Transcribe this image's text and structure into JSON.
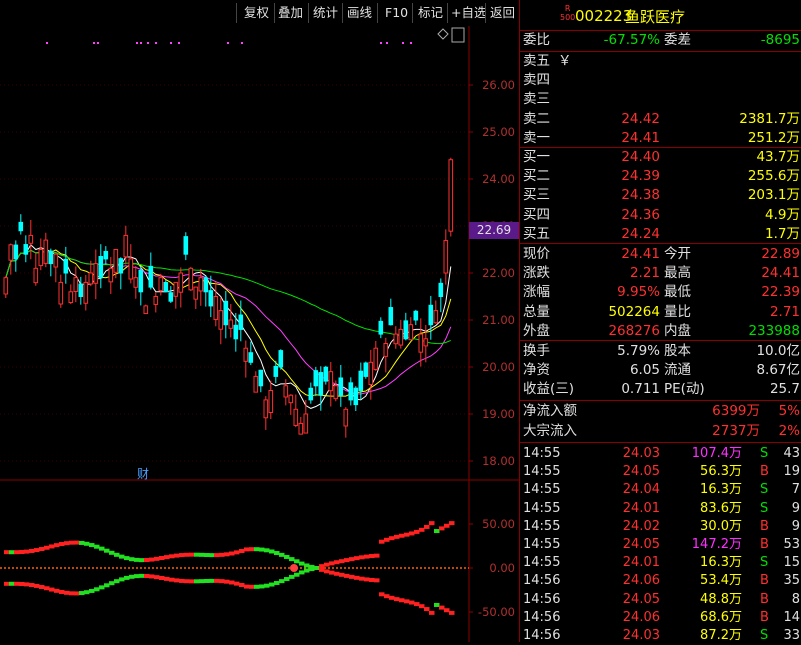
{
  "toolbar": {
    "buttons": [
      "复权",
      "叠加",
      "统计",
      "画线",
      "F10",
      "标记",
      "+自选",
      "返回"
    ]
  },
  "stock": {
    "badge_top": "R",
    "badge_bottom": "500",
    "code": "002223",
    "name": "鱼跃医疗"
  },
  "chart": {
    "price_ticks": [
      "26.00",
      "25.00",
      "24.00",
      "23.00",
      "22.00",
      "21.00",
      "20.00",
      "19.00",
      "18.00"
    ],
    "current_price_label": "22.69",
    "news_marker": "财",
    "indicator_ticks": [
      "50.00",
      "0.00",
      "-50.00"
    ],
    "colors": {
      "up": "#ff3030",
      "down": "#00ffff",
      "ma5": "#ffffff",
      "ma10": "#ffff00",
      "ma20": "#ff40ff",
      "ma60": "#00e000"
    }
  },
  "ratio": {
    "label1": "委比",
    "value1": "-67.57%",
    "label2": "委差",
    "value2": "-8695"
  },
  "sell_orders": [
    {
      "label": "卖五",
      "price": "￥",
      "volume": ""
    },
    {
      "label": "卖四",
      "price": "",
      "volume": ""
    },
    {
      "label": "卖三",
      "price": "",
      "volume": ""
    },
    {
      "label": "卖二",
      "price": "24.42",
      "volume": "2381.7万"
    },
    {
      "label": "卖一",
      "price": "24.41",
      "volume": "251.2万"
    }
  ],
  "buy_orders": [
    {
      "label": "买一",
      "price": "24.40",
      "volume": "43.7万"
    },
    {
      "label": "买二",
      "price": "24.39",
      "volume": "255.6万"
    },
    {
      "label": "买三",
      "price": "24.38",
      "volume": "203.1万"
    },
    {
      "label": "买四",
      "price": "24.36",
      "volume": "4.9万"
    },
    {
      "label": "买五",
      "price": "24.24",
      "volume": "1.7万"
    }
  ],
  "quote": [
    {
      "l1": "现价",
      "v1": "24.41",
      "l2": "今开",
      "v2": "22.89"
    },
    {
      "l1": "涨跌",
      "v1": "2.21",
      "l2": "最高",
      "v2": "24.41"
    },
    {
      "l1": "涨幅",
      "v1": "9.95%",
      "l2": "最低",
      "v2": "22.39"
    },
    {
      "l1": "总量",
      "v1": "502264",
      "l2": "量比",
      "v2": "2.71"
    },
    {
      "l1": "外盘",
      "v1": "268276",
      "l2": "内盘",
      "v2": "233988"
    }
  ],
  "fundamentals": [
    {
      "l1": "换手",
      "v1": "5.79%",
      "l2": "股本",
      "v2": "10.0亿"
    },
    {
      "l1": "净资",
      "v1": "6.05",
      "l2": "流通",
      "v2": "8.67亿"
    },
    {
      "l1": "收益(三)",
      "v1": "0.711",
      "l2": "PE(动)",
      "v2": "25.7"
    }
  ],
  "flows": [
    {
      "label": "净流入额",
      "value": "6399万",
      "pct": "5%"
    },
    {
      "label": "大宗流入",
      "value": "2737万",
      "pct": "2%"
    }
  ],
  "trades": [
    {
      "time": "14:55",
      "price": "24.03",
      "vol": "107.4万",
      "side": "S",
      "count": "43"
    },
    {
      "time": "14:55",
      "price": "24.05",
      "vol": "56.3万",
      "side": "B",
      "count": "19"
    },
    {
      "time": "14:55",
      "price": "24.04",
      "vol": "16.3万",
      "side": "S",
      "count": "7"
    },
    {
      "time": "14:55",
      "price": "24.01",
      "vol": "83.6万",
      "side": "S",
      "count": "9"
    },
    {
      "time": "14:55",
      "price": "24.02",
      "vol": "30.0万",
      "side": "B",
      "count": "9"
    },
    {
      "time": "14:55",
      "price": "24.05",
      "vol": "147.2万",
      "side": "B",
      "count": "53"
    },
    {
      "time": "14:55",
      "price": "24.01",
      "vol": "16.3万",
      "side": "S",
      "count": "15"
    },
    {
      "time": "14:56",
      "price": "24.06",
      "vol": "53.4万",
      "side": "B",
      "count": "35"
    },
    {
      "time": "14:56",
      "price": "24.05",
      "vol": "48.8万",
      "side": "B",
      "count": "8"
    },
    {
      "time": "14:56",
      "price": "24.06",
      "vol": "68.6万",
      "side": "B",
      "count": "14"
    },
    {
      "time": "14:56",
      "price": "24.03",
      "vol": "87.2万",
      "side": "S",
      "count": "33"
    }
  ]
}
